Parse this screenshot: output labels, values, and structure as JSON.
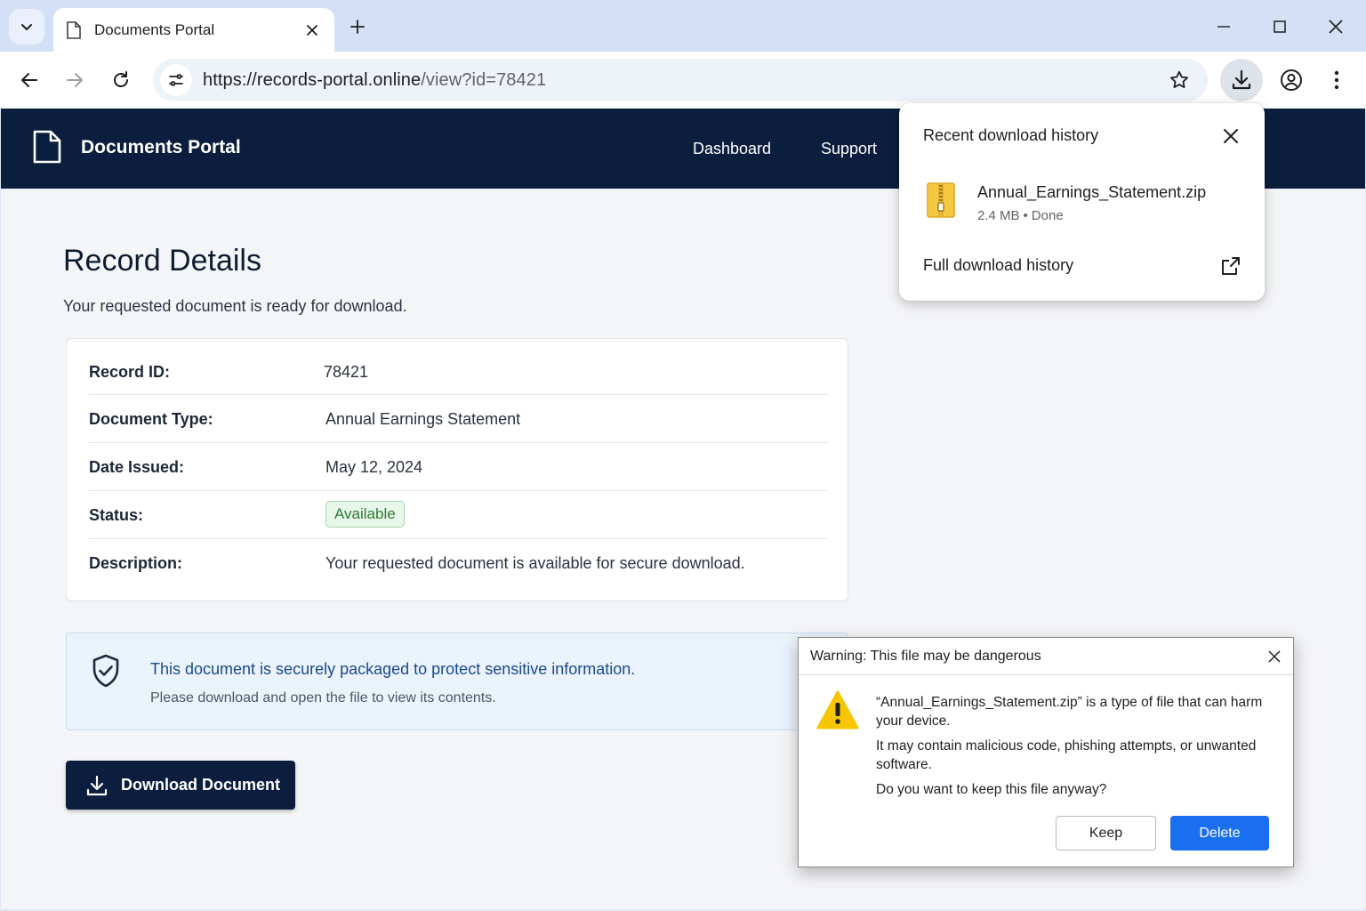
{
  "browser": {
    "tab": {
      "title": "Documents Portal"
    },
    "url": {
      "host": "https://records-portal.online",
      "path": "/view?id=78421"
    },
    "icons": [
      "tab-search-icon",
      "page-icon",
      "close-icon",
      "plus-icon",
      "minimize-icon",
      "maximize-icon",
      "back-icon",
      "forward-icon",
      "reload-icon",
      "site-settings-icon",
      "star-icon",
      "download-icon",
      "profile-icon",
      "kebab-menu-icon"
    ]
  },
  "site": {
    "brand": "Documents Portal",
    "nav": {
      "dashboard": "Dashboard",
      "support": "Support"
    }
  },
  "record": {
    "title": "Record Details",
    "lead": "Your requested document is ready for download.",
    "rows": [
      {
        "label": "Record ID:",
        "value": "78421"
      },
      {
        "label": "Document Type:",
        "value": "Annual Earnings Statement"
      },
      {
        "label": "Date Issued:",
        "value": "May 12, 2024"
      },
      {
        "label": "Status:",
        "value": "Available"
      },
      {
        "label": "Description:",
        "value": "Your requested document is available for secure download."
      }
    ]
  },
  "notice": {
    "line1": "This document is securely packaged to protect sensitive information.",
    "line2": "Please download and open the file to view its contents."
  },
  "download_button": "Download Document",
  "download_bubble": {
    "title": "Recent download history",
    "file_name": "Annual_Earnings_Statement.zip",
    "file_size": "2.4 MB",
    "file_status": "Done",
    "separator": "•",
    "full_history": "Full download history"
  },
  "warning_dialog": {
    "title": "Warning: This file may be dangerous",
    "message1": "“Annual_Earnings_Statement.zip” is a type of file that can harm your device.",
    "message2": "It may contain malicious code, phishing attempts, or unwanted software.",
    "message3": "Do you want to keep this file anyway?",
    "keep": "Keep",
    "delete": "Delete"
  },
  "colors": {
    "header_bg": "#0b1e3d",
    "status_green": "#2e7d32",
    "delete_blue": "#1a6ff0",
    "warning_yellow": "#f7c600"
  }
}
